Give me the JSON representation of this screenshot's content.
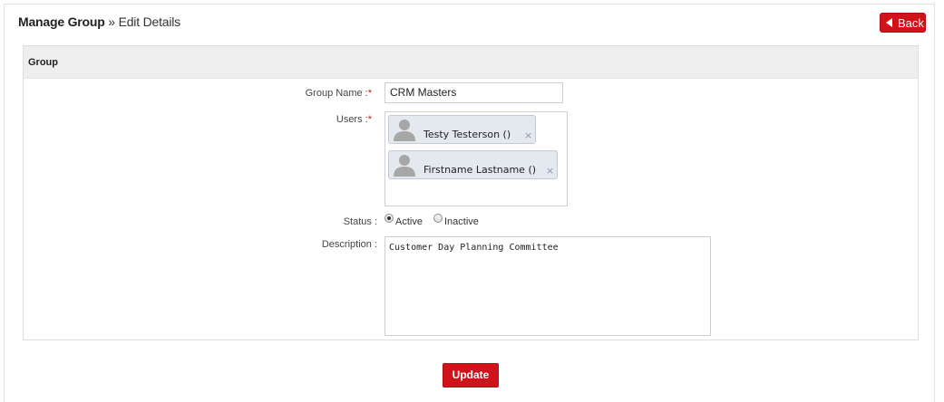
{
  "breadcrumb": {
    "section": "Manage Group",
    "separator": " » ",
    "page": "Edit Details"
  },
  "back_button": {
    "label": "Back"
  },
  "panel": {
    "title": "Group"
  },
  "form": {
    "group_name": {
      "label": "Group Name :",
      "required_mark": "*",
      "value": "CRM Masters"
    },
    "users": {
      "label": "Users :",
      "required_mark": "*",
      "items": [
        {
          "name": "Testy Testerson ()",
          "remove": "×"
        },
        {
          "name": "Firstname Lastname ()",
          "remove": "×"
        }
      ]
    },
    "status": {
      "label": "Status :",
      "options": [
        {
          "label": "Active",
          "selected": true
        },
        {
          "label": "Inactive",
          "selected": false
        }
      ]
    },
    "description": {
      "label": "Description :",
      "value": "Customer Day Planning Committee"
    }
  },
  "update_button": {
    "label": "Update"
  },
  "colors": {
    "accent": "#d0121b",
    "panel_header": "#eeeeee",
    "chip_bg": "#e4e8ef"
  }
}
